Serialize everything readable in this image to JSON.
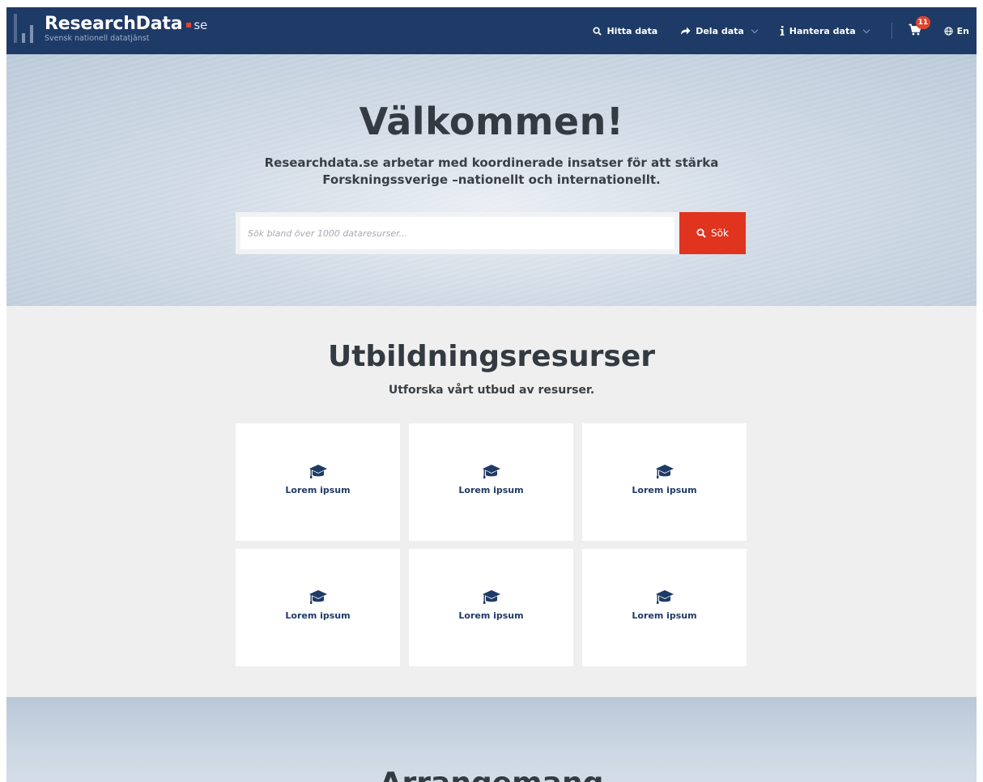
{
  "header": {
    "brand": "ResearchData",
    "brand_tld": "se",
    "tagline": "Svensk nationell datatjänst",
    "nav": [
      {
        "label": "Hitta data",
        "icon": "search-icon"
      },
      {
        "label": "Dela data",
        "icon": "share-icon",
        "has_dropdown": true
      },
      {
        "label": "Hantera data",
        "icon": "info-icon",
        "has_dropdown": true
      }
    ],
    "cart_count": "11",
    "language_label": "En"
  },
  "hero": {
    "title": "Välkommen!",
    "subtitle": "Researchdata.se arbetar med koordinerade insatser för att stärka Forskningssverige –nationellt och internationellt.",
    "search_placeholder": "Sök bland över 1000 dataresurser...",
    "search_button": "Sök"
  },
  "resources": {
    "title": "Utbildningsresurser",
    "subtitle": "Utforska vårt utbud av resurser.",
    "cards": [
      {
        "label": "Lorem ipsum",
        "icon": "graduation-cap-icon"
      },
      {
        "label": "Lorem ipsum",
        "icon": "graduation-cap-icon"
      },
      {
        "label": "Lorem ipsum",
        "icon": "graduation-cap-icon"
      },
      {
        "label": "Lorem ipsum",
        "icon": "graduation-cap-icon"
      },
      {
        "label": "Lorem ipsum",
        "icon": "graduation-cap-icon"
      },
      {
        "label": "Lorem ipsum",
        "icon": "graduation-cap-icon"
      }
    ]
  },
  "events": {
    "title": "Arrangemang"
  },
  "colors": {
    "navy": "#1e3a66",
    "accent_red": "#e0341f",
    "section_bg": "#efefef"
  }
}
